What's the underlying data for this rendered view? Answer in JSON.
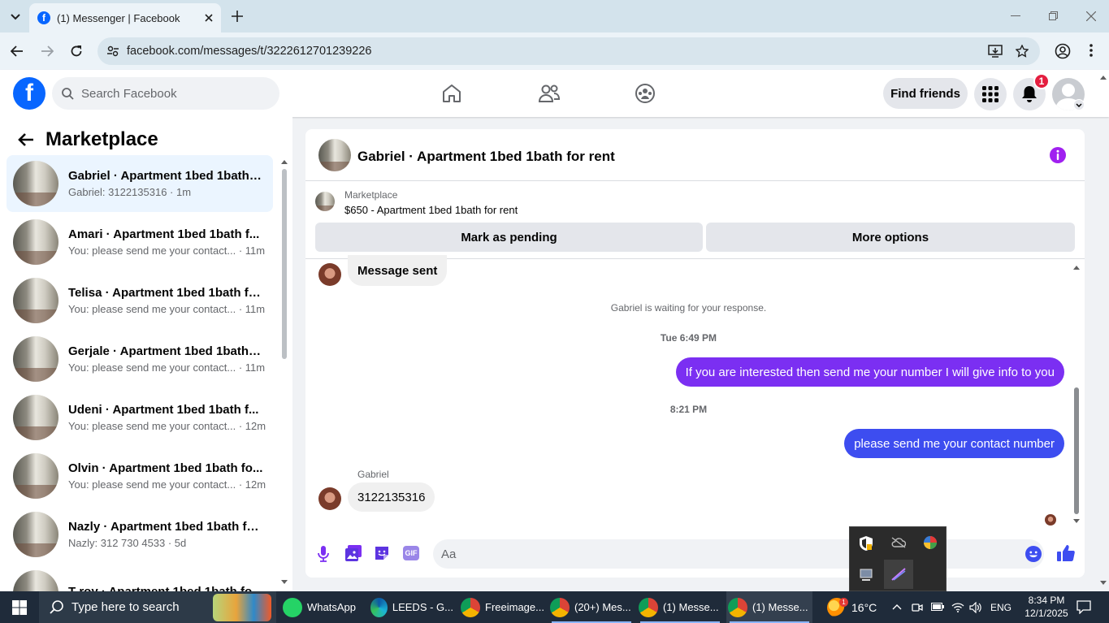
{
  "browser": {
    "tab_title": "(1) Messenger | Facebook",
    "url": "facebook.com/messages/t/3222612701239226"
  },
  "header": {
    "logo": "f",
    "search_placeholder": "Search Facebook",
    "find_friends": "Find friends",
    "notification_count": "1"
  },
  "sidebar": {
    "title": "Marketplace",
    "conversations": [
      {
        "name": "Gabriel · Apartment 1bed 1bath f...",
        "preview": "Gabriel: 3122135316 · 1m"
      },
      {
        "name": "Amari · Apartment 1bed 1bath f...",
        "preview": "You: please send me your contact... · 11m"
      },
      {
        "name": "Telisa · Apartment 1bed 1bath fo...",
        "preview": "You: please send me your contact... · 11m"
      },
      {
        "name": "Gerjale · Apartment 1bed 1bath f...",
        "preview": "You: please send me your contact... · 11m"
      },
      {
        "name": "Udeni · Apartment 1bed 1bath f...",
        "preview": "You: please send me your contact... · 12m"
      },
      {
        "name": "Olvin · Apartment 1bed 1bath fo...",
        "preview": "You: please send me your contact... · 12m"
      },
      {
        "name": "Nazly · Apartment 1bed 1bath fo...",
        "preview": "Nazly: 312 730 4533 · 5d"
      },
      {
        "name": "T-roy · Apartment 1bed 1bath fo...",
        "preview": ""
      }
    ]
  },
  "chat": {
    "title": "Gabriel · Apartment 1bed 1bath for rent",
    "listing_label": "Marketplace",
    "listing_title": "$650 - Apartment 1bed 1bath for rent",
    "mark_pending": "Mark as pending",
    "more_options": "More options",
    "msg_sent": "Message sent",
    "waiting": "Gabriel is waiting for your response.",
    "time1": "Tue 6:49 PM",
    "msg_interested": "If you are interested then send me your number I will give info to you",
    "time2": "8:21 PM",
    "msg_contact": "please send me your contact number",
    "sender_label": "Gabriel",
    "msg_number": "3122135316",
    "input_placeholder": "Aa",
    "gif_label": "GIF"
  },
  "taskbar": {
    "search_placeholder": "Type here to search",
    "apps": [
      {
        "label": "WhatsApp"
      },
      {
        "label": "LEEDS - G..."
      },
      {
        "label": "Freeimage..."
      },
      {
        "label": "(20+) Mes..."
      },
      {
        "label": "(1) Messe..."
      },
      {
        "label": "(1) Messe..."
      }
    ],
    "weather": "16°C",
    "weather_badge": "1",
    "language": "ENG",
    "time": "8:34 PM",
    "date": "12/1/2025"
  },
  "colors": {
    "fb_blue": "#0866ff",
    "sent_purple": "#7b2ff2",
    "sent_blue": "#3d4df0",
    "accent": "#a020f0"
  }
}
